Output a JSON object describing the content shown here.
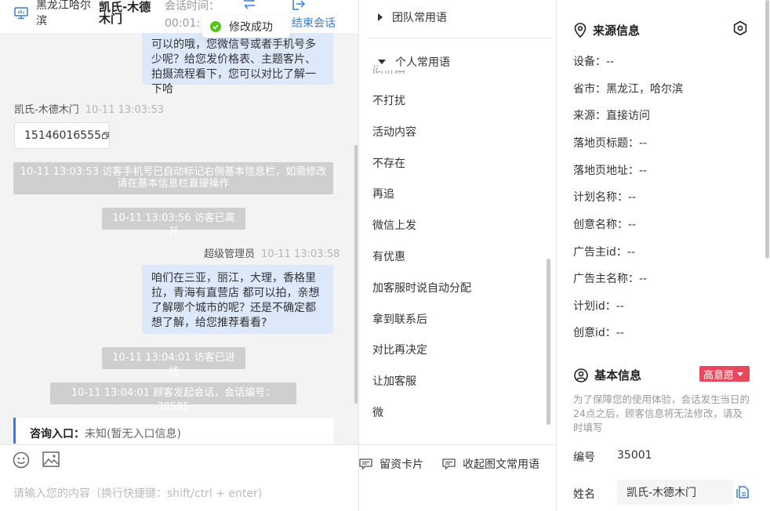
{
  "topbar": {
    "location": "黑龙江哈尔滨",
    "visitor_name": "凯氏-木德木门",
    "session_time_label": "会话时间：",
    "session_time_value": "00:01:",
    "end_session_label": "结束会话"
  },
  "toast": {
    "text": "修改成功"
  },
  "chat": {
    "bubble_top_text": "可以的哦，您微信号或者手机号多少呢？给您发价格表、主题客片、拍摄流程看下，您可以对比了解一下哈",
    "visitor_sender": "凯氏-木德木门",
    "visitor_time": "10-11 13:03:53",
    "phone_number": "15146016555",
    "sys_phone_tagged": "10-11 13:03:53 访客手机号已自动标记右侧基本信息栏，如需修改请在基本信息栏直接操作",
    "sys_left": "10-11 13:03:56 访客已离开",
    "agent_sender": "超级管理员",
    "agent_time": "10-11 13:03:58",
    "agent_bubble": "咱们在三亚，丽江，大理，香格里拉，青海有直营店 都可以拍，亲想了解哪个城市的呢？还是不确定都想了解，给您推荐看看?",
    "sys_entered": "10-11 13:04:01 访客已进线",
    "sys_started": "10-11 13:04:01 顾客发起会话，会话编号：38585",
    "entry_label": "咨询入口：",
    "entry_value": "未知(暂无入口信息)"
  },
  "input": {
    "placeholder": "请输入您的内容（换行快捷键：shift/ctrl + enter)"
  },
  "phrases": {
    "team_group": "团队常用语",
    "personal_group": "个人常用语",
    "partial_item": "问价格",
    "items": [
      "不打扰",
      "活动内容",
      "不存在",
      "再追",
      "微信上发",
      "有优惠",
      "加客服时说自动分配",
      "拿到联系后",
      "对比再决定",
      "让加客服",
      "微"
    ],
    "footer_card": "留资卡片",
    "footer_collapse": "收起图文常用语"
  },
  "source_info": {
    "title": "来源信息",
    "rows": [
      "设备：--",
      "省市：黑龙江，哈尔滨",
      "来源：直接访问",
      "落地页标题：--",
      "落地页地址：--",
      "计划名称：--",
      "创意名称：--",
      "广告主id：--",
      "广告主名称：--",
      "计划id：--",
      "创意id：--"
    ]
  },
  "basic_info": {
    "title": "基本信息",
    "intent_badge": "高意愿",
    "notice": "为了保障您的使用体验，会话发生当日的24点之后，顾客信息将无法修改，请及时填写",
    "id_label": "编号",
    "id_value": "35001",
    "name_label": "姓名",
    "name_value": "凯氏-木德木门"
  },
  "colors": {
    "accent": "#3a7bd5",
    "bubble": "#dde8fa",
    "system_msg": "#cfcfcf",
    "badge": "#e9475b",
    "success": "#52c41a"
  }
}
